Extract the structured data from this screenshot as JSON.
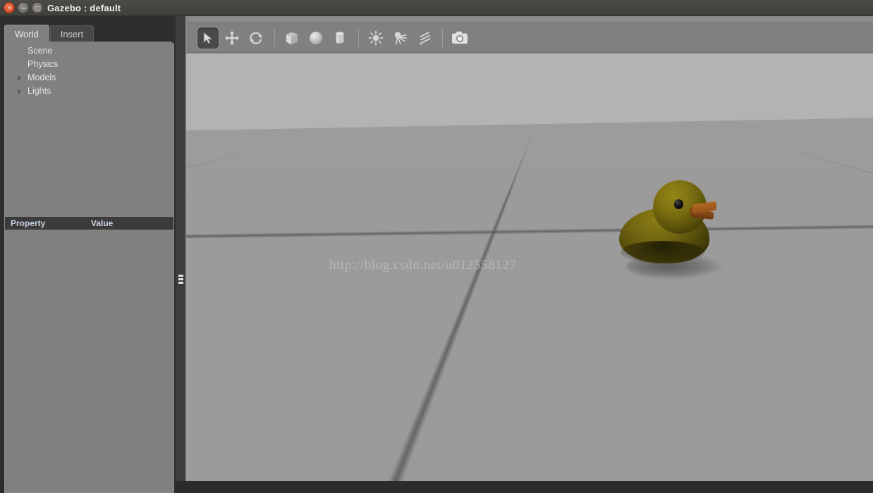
{
  "window": {
    "title": "Gazebo : default",
    "controls": [
      {
        "name": "close",
        "glyph": "×"
      },
      {
        "name": "minimize",
        "glyph": "−"
      },
      {
        "name": "maximize",
        "glyph": "□"
      }
    ]
  },
  "left_panel": {
    "tabs": [
      {
        "label": "World",
        "active": true
      },
      {
        "label": "Insert",
        "active": false
      }
    ],
    "tree": [
      {
        "label": "Scene",
        "expandable": false
      },
      {
        "label": "Physics",
        "expandable": false
      },
      {
        "label": "Models",
        "expandable": true
      },
      {
        "label": "Lights",
        "expandable": true
      }
    ],
    "property_table": {
      "columns": [
        "Property",
        "Value"
      ],
      "rows": []
    }
  },
  "toolbar": {
    "items": [
      {
        "name": "select-mode",
        "icon": "cursor-arrow-icon",
        "pressed": true
      },
      {
        "name": "translate-mode",
        "icon": "move-arrows-icon",
        "pressed": false
      },
      {
        "name": "rotate-mode",
        "icon": "rotate-icon",
        "pressed": false
      },
      {
        "name": "separator-1",
        "icon": "separator",
        "pressed": false
      },
      {
        "name": "insert-box",
        "icon": "box-icon",
        "pressed": false
      },
      {
        "name": "insert-sphere",
        "icon": "sphere-icon",
        "pressed": false
      },
      {
        "name": "insert-cylinder",
        "icon": "cylinder-icon",
        "pressed": false
      },
      {
        "name": "separator-2",
        "icon": "separator",
        "pressed": false
      },
      {
        "name": "insert-point-light",
        "icon": "point-light-icon",
        "pressed": false
      },
      {
        "name": "insert-spot-light",
        "icon": "spot-light-icon",
        "pressed": false
      },
      {
        "name": "insert-directional-light",
        "icon": "directional-light-icon",
        "pressed": false
      },
      {
        "name": "separator-3",
        "icon": "separator",
        "pressed": false
      },
      {
        "name": "screenshot",
        "icon": "camera-icon",
        "pressed": false
      }
    ]
  },
  "viewport": {
    "watermark": "http://blog.csdn.net/u012558127",
    "models": [
      {
        "name": "rubber-duck",
        "body_color": "#6e6310",
        "beak_color": "#95511a",
        "eye_color": "#000000"
      }
    ],
    "sky_color": "#b3b3b3",
    "ground_color": "#9b9b9b",
    "grid_line_color": "#5a5a5a"
  },
  "colors": {
    "titlebar": "#413f3c",
    "panel_bg": "#808080",
    "dock_bg": "#2e2e2e",
    "header_bg": "#3b3b3b",
    "header_text": "#c9d4e0",
    "close_button": "#d9522a"
  }
}
